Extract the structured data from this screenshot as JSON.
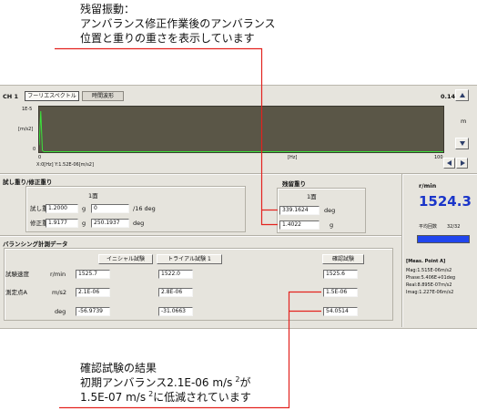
{
  "callout_top": {
    "lines": [
      "残留振動：",
      "アンバランス修正作業後のアンバランス",
      "位置と重りの重さを表示しています"
    ]
  },
  "callout_bottom": {
    "line1": "確認試験の結果",
    "line2": {
      "pre": "初期アンバランス2.1E-06 m/s",
      "sup": "2",
      "post": "が"
    },
    "line3": {
      "pre": "1.5E-07 m/s",
      "sup": "2",
      "post": "に低減されています"
    }
  },
  "colors": {
    "callout_line": "#e3231f",
    "value_blue": "#1a35c9",
    "plot_background": "#5a5647",
    "trace": "#3be23b",
    "progress": "#2146ee"
  },
  "header": {
    "channel": "CH 1",
    "tabs": [
      {
        "label": "フーリエスペクトル",
        "active": true
      },
      {
        "label": "時間波形",
        "active": false
      }
    ],
    "voltage": "0.141 V"
  },
  "icons": {
    "scale_up": "triangle-up-icon",
    "scale_down": "triangle-down-icon",
    "prev": "triangle-left-icon",
    "next": "triangle-right-icon"
  },
  "scale_label": "m",
  "cursor_readout": "X:0[Hz] Y:1.52E-06[m/s2]",
  "chart_data": {
    "type": "line",
    "title": "",
    "xlabel": "[Hz]",
    "ylabel": "[m/s2]",
    "x_range": [
      0,
      100
    ],
    "y_range": [
      0,
      1e-05
    ],
    "x_tick_labels": [
      "0",
      "100"
    ],
    "y_tick_labels": [
      "0",
      "1E-5"
    ],
    "grid": false,
    "series": [
      {
        "x": [
          0,
          0.4,
          0.8,
          1.2,
          100
        ],
        "y": [
          1.52e-06,
          9e-06,
          4e-07,
          0,
          0
        ]
      }
    ]
  },
  "weights": {
    "heading": "試し重り/修正重り",
    "plane": "1面",
    "rows": [
      {
        "label": "試し重り",
        "mass": "1.2000",
        "mass_unit": "g",
        "angle": "0",
        "angle_unit": "/16 deg"
      },
      {
        "label": "修正重り",
        "mass": "1.9177",
        "mass_unit": "g",
        "angle": "250.1937",
        "angle_unit": "deg"
      }
    ]
  },
  "residual": {
    "heading": "残留重り",
    "plane": "1面",
    "angle": "339.1624",
    "angle_unit": "deg",
    "mass": "1.4022",
    "mass_unit": "g"
  },
  "speed": {
    "unit": "r/min",
    "value": "1524.3",
    "avg_label": "平均回数",
    "avg_count": "32/32",
    "avg_progress": 1.0
  },
  "measurement": {
    "heading": "バランシング計測データ",
    "columns": [
      "イニシャル試験",
      "トライアル試験 1",
      "確認試験"
    ],
    "rows": [
      {
        "label": "試験速度",
        "unit": "r/min",
        "values": [
          "1525.7",
          "1522.0",
          "1525.6"
        ]
      },
      {
        "label": "測定点A",
        "unit": "m/s2",
        "values": [
          "2.1E-06",
          "2.8E-06",
          "1.5E-06"
        ]
      },
      {
        "label": "",
        "unit": "deg",
        "values": [
          "-56.9739",
          "-31.0663",
          "54.0514"
        ]
      }
    ]
  },
  "point_info": {
    "title": "[Meas. Point A]",
    "lines": [
      "Mag:1.515E-06m/s2",
      "Phase:5.406E+01deg",
      "Real:8.895E-07m/s2",
      "Imag:1.227E-06m/s2"
    ]
  }
}
